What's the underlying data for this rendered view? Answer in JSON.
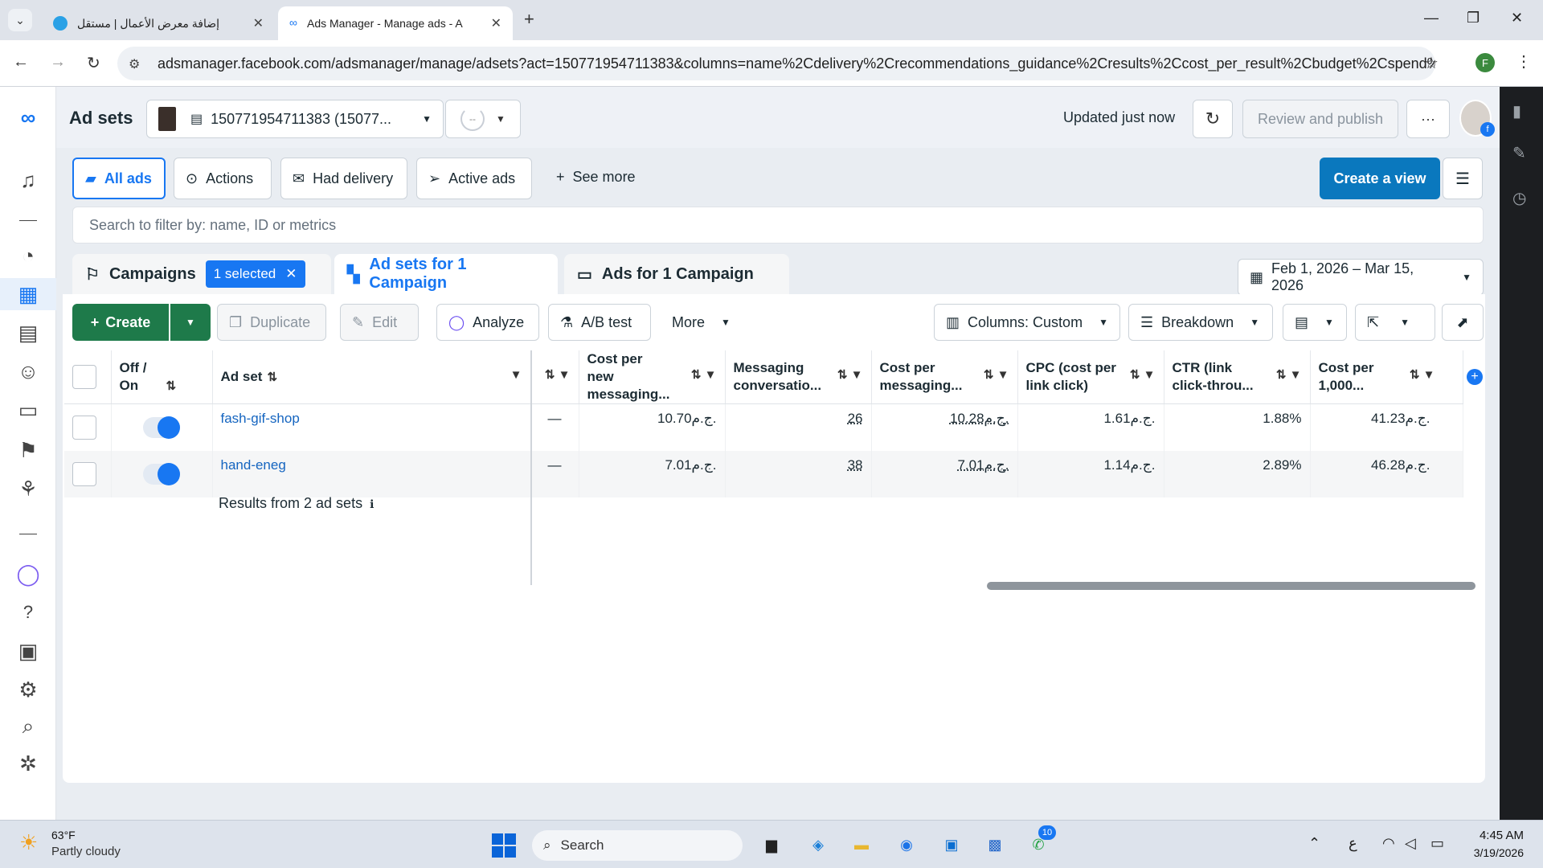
{
  "browser": {
    "tabs": [
      {
        "title": "إضافة معرض الأعمال | مستقل",
        "active": false
      },
      {
        "title": "Ads Manager - Manage ads - A",
        "active": true
      }
    ],
    "url": "adsmanager.facebook.com/adsmanager/manage/adsets?act=150771954711383&columns=name%2Cdelivery%2Crecommendations_guidance%2Cresults%2Ccost_per_result%2Cbudget%2Cspend%2Ci...",
    "profile_initial": "F"
  },
  "header": {
    "title": "Ad sets",
    "account": "150771954711383 (15077...",
    "status_placeholder": "--",
    "updated": "Updated just now",
    "review_publish": "Review and publish",
    "more": "···"
  },
  "filters": {
    "all_ads": "All ads",
    "actions": "Actions",
    "had_delivery": "Had delivery",
    "active_ads": "Active ads",
    "see_more": "See more",
    "create_view": "Create a view",
    "search_placeholder": "Search to filter by: name, ID or metrics"
  },
  "levels": {
    "campaigns": "Campaigns",
    "selected": "1 selected",
    "adsets": "Ad sets for 1 Campaign",
    "ads": "Ads for 1 Campaign",
    "date_range": "Feb 1, 2026 – Mar 15, 2026"
  },
  "toolbar": {
    "create": "Create",
    "duplicate": "Duplicate",
    "edit": "Edit",
    "analyze": "Analyze",
    "ab_test": "A/B test",
    "more": "More",
    "columns": "Columns: Custom",
    "breakdown": "Breakdown"
  },
  "table": {
    "headers": {
      "off_on": "Off / On",
      "ad_set": "Ad set",
      "c1": "Cost per new messaging...",
      "c2": "Messaging conversatio...",
      "c3": "Cost per messaging...",
      "c4": "CPC (cost per link click)",
      "c5": "CTR (link click-throu...",
      "c6": "Cost per 1,000..."
    },
    "rows": [
      {
        "name": "fash-gif-shop",
        "on": true,
        "blank": "—",
        "c1": "10.70ج.م.",
        "c2": "26",
        "c3": "10.28ج.م.",
        "c4": "1.61ج.م.",
        "c5": "1.88%",
        "c6": "41.23ج.م."
      },
      {
        "name": "hand-eneg",
        "on": true,
        "blank": "—",
        "c1": "7.01ج.م.",
        "c2": "38",
        "c3": "7.01ج.م.",
        "c4": "1.14ج.م.",
        "c5": "2.89%",
        "c6": "46.28ج.م."
      }
    ],
    "results_label": "Results from 2 ad sets"
  },
  "taskbar": {
    "temp": "63°F",
    "weather": "Partly cloudy",
    "search": "Search",
    "whatsapp_badge": "10",
    "lang": "ع",
    "time": "4:45 AM",
    "date": "3/19/2026"
  },
  "colors": {
    "brand_blue": "#1877f2",
    "create_green": "#1e7a4a",
    "create_view_blue": "#0a78be"
  }
}
